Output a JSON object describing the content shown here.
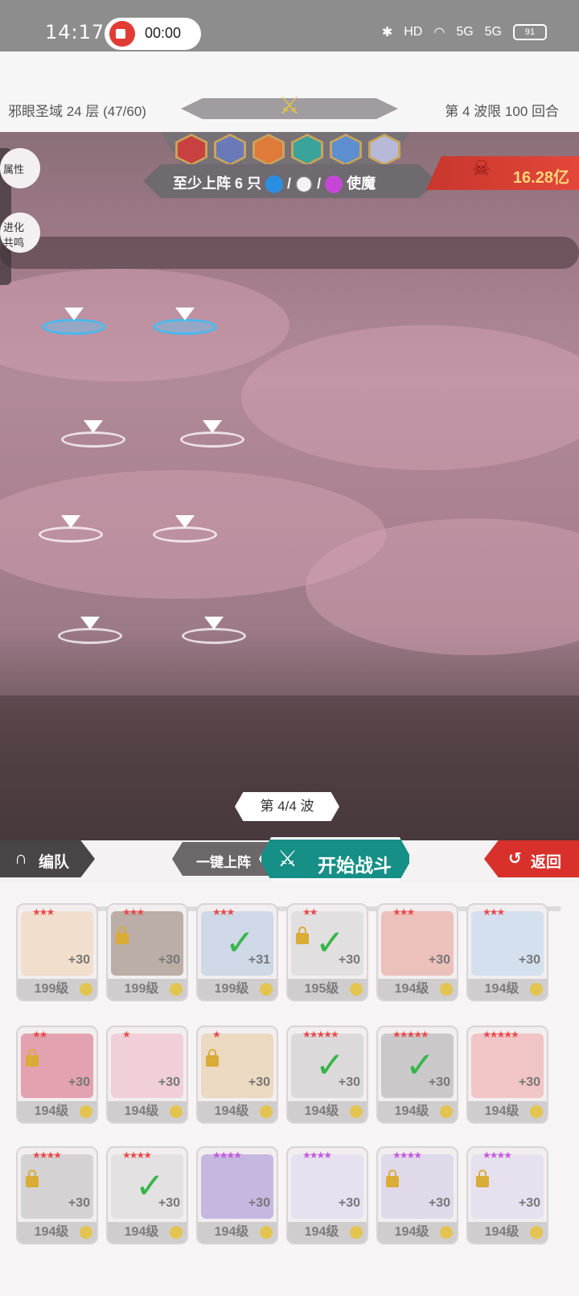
{
  "status_bar": {
    "time": "14:17",
    "record_time": "00:00",
    "icons": [
      "bluetooth-icon",
      "hd-icon",
      "wifi-icon",
      "5g-signal-icon",
      "5g-signal-icon"
    ],
    "battery": "91",
    "hd_label": "HD",
    "net_label_1": "5G",
    "net_label_2": "5G"
  },
  "header": {
    "stage": "邪眼圣域 24 层 (47/60)",
    "wave_limit": "第 4 波限 100 回合"
  },
  "battlefield": {
    "requirement": "至少上阵 6 只",
    "requirement_suffix": "使魔",
    "separator": "/",
    "power": "16.28亿",
    "wave": "第 4/4 波",
    "side_buttons": [
      "属性",
      "进化\n共鸣"
    ],
    "enemy_colors": [
      "#c84040",
      "#6a7ab8",
      "#e07a3a",
      "#3aa39a",
      "#5d8fd0",
      "#b7b9d8"
    ]
  },
  "actions": {
    "formation": "编队",
    "auto_deploy": "一键上阵",
    "start_battle": "开始战斗",
    "back": "返回"
  },
  "roster": [
    {
      "level": "199级",
      "plus": "+30",
      "stars": "★★★",
      "locked": false,
      "selected": false,
      "color": "#f3d2b0"
    },
    {
      "level": "199级",
      "plus": "+30",
      "stars": "★★★",
      "locked": true,
      "selected": false,
      "color": "#8c7a6b"
    },
    {
      "level": "199级",
      "plus": "+31",
      "stars": "★★★",
      "locked": false,
      "selected": true,
      "color": "#b0c6de"
    },
    {
      "level": "195级",
      "plus": "+30",
      "stars": "★★",
      "locked": true,
      "selected": true,
      "color": "#d3d3d3"
    },
    {
      "level": "194级",
      "plus": "+30",
      "stars": "★★★",
      "locked": false,
      "selected": false,
      "color": "#e79a90"
    },
    {
      "level": "194级",
      "plus": "+30",
      "stars": "★★★",
      "locked": false,
      "selected": false,
      "color": "#bcd6ec"
    },
    {
      "level": "194级",
      "plus": "+30",
      "stars": "★★",
      "locked": true,
      "selected": false,
      "color": "#d6657a"
    },
    {
      "level": "194级",
      "plus": "+30",
      "stars": "★",
      "locked": false,
      "selected": false,
      "color": "#eeb6c4"
    },
    {
      "level": "194级",
      "plus": "+30",
      "stars": "★",
      "locked": true,
      "selected": false,
      "color": "#e6c99a"
    },
    {
      "level": "194级",
      "plus": "+30",
      "stars": "★★★★★",
      "locked": false,
      "selected": true,
      "color": "#c9c9c9"
    },
    {
      "level": "194级",
      "plus": "+30",
      "stars": "★★★★★",
      "locked": false,
      "selected": true,
      "color": "#a9a9a9"
    },
    {
      "level": "194级",
      "plus": "+30",
      "stars": "★★★★★",
      "locked": false,
      "selected": false,
      "color": "#f0a3a3"
    },
    {
      "level": "194级",
      "plus": "+30",
      "stars": "★★★★",
      "locked": true,
      "selected": false,
      "color": "#bcbcbc"
    },
    {
      "level": "194级",
      "plus": "+30",
      "stars": "★★★★",
      "locked": false,
      "selected": true,
      "color": "#d7d7d7"
    },
    {
      "level": "194级",
      "plus": "+30",
      "stars": "★★★★",
      "locked": false,
      "selected": false,
      "color": "#a28ad6",
      "purple": true
    },
    {
      "level": "194级",
      "plus": "+30",
      "stars": "★★★★",
      "locked": false,
      "selected": false,
      "color": "#ddd6f2",
      "purple": true
    },
    {
      "level": "194级",
      "plus": "+30",
      "stars": "★★★★",
      "locked": true,
      "selected": false,
      "color": "#d1c9e6",
      "purple": true
    },
    {
      "level": "194级",
      "plus": "+30",
      "stars": "★★★★",
      "locked": true,
      "selected": false,
      "color": "#ded6ee",
      "purple": true
    }
  ]
}
